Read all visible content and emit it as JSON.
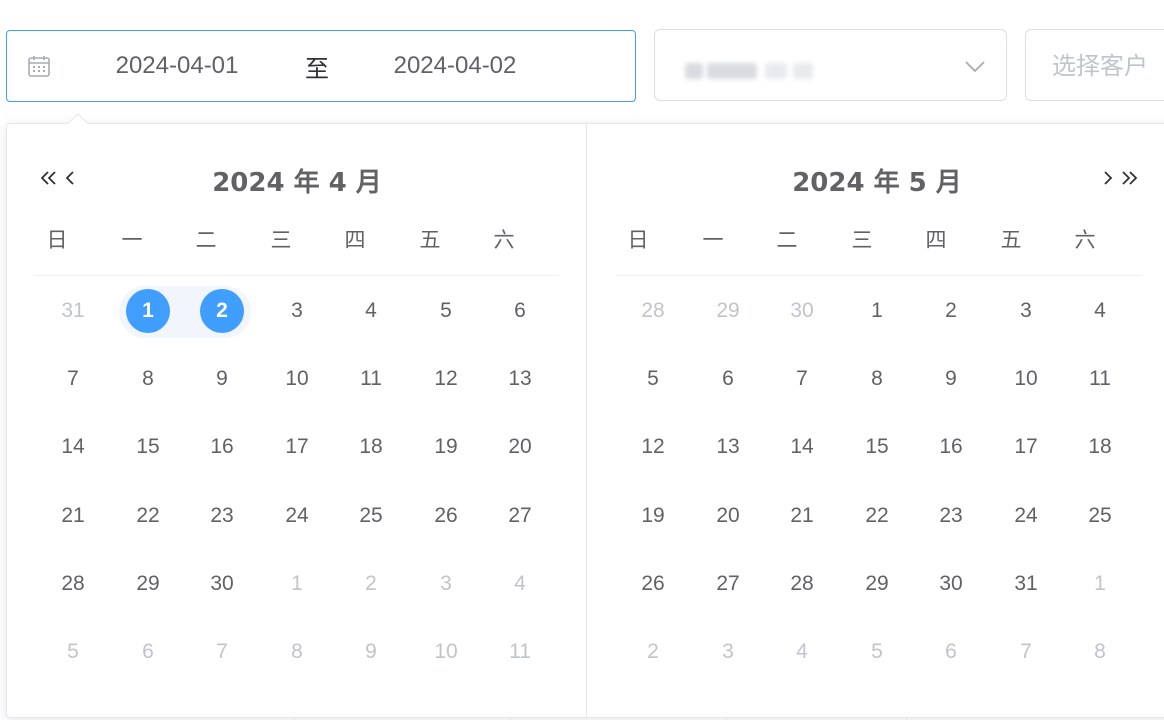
{
  "date_range": {
    "start": "2024-04-01",
    "separator": "至",
    "end": "2024-04-02"
  },
  "customer": {
    "placeholder": "选择客户"
  },
  "colors": {
    "accent": "#409eff",
    "range_band": "#f2f6fc",
    "text": "#606266",
    "muted": "#c0c4cc",
    "border": "#dcdfe6"
  },
  "icons": {
    "date_input": "calendar-icon",
    "select": "chevron-down-icon",
    "prev_year": "double-chevron-left-icon",
    "prev_month": "chevron-left-icon",
    "next_month": "chevron-right-icon",
    "next_year": "double-chevron-right-icon"
  },
  "weekdays": [
    "日",
    "一",
    "二",
    "三",
    "四",
    "五",
    "六"
  ],
  "calendars": [
    {
      "title": "2024 年 4 月",
      "weeks": [
        [
          {
            "d": "31",
            "o": true
          },
          {
            "d": "1",
            "s": true
          },
          {
            "d": "2",
            "s": true
          },
          {
            "d": "3"
          },
          {
            "d": "4"
          },
          {
            "d": "5"
          },
          {
            "d": "6"
          }
        ],
        [
          {
            "d": "7"
          },
          {
            "d": "8"
          },
          {
            "d": "9"
          },
          {
            "d": "10"
          },
          {
            "d": "11"
          },
          {
            "d": "12"
          },
          {
            "d": "13"
          }
        ],
        [
          {
            "d": "14"
          },
          {
            "d": "15"
          },
          {
            "d": "16"
          },
          {
            "d": "17"
          },
          {
            "d": "18"
          },
          {
            "d": "19"
          },
          {
            "d": "20"
          }
        ],
        [
          {
            "d": "21"
          },
          {
            "d": "22"
          },
          {
            "d": "23"
          },
          {
            "d": "24"
          },
          {
            "d": "25"
          },
          {
            "d": "26"
          },
          {
            "d": "27"
          }
        ],
        [
          {
            "d": "28"
          },
          {
            "d": "29"
          },
          {
            "d": "30"
          },
          {
            "d": "1",
            "o": true
          },
          {
            "d": "2",
            "o": true
          },
          {
            "d": "3",
            "o": true
          },
          {
            "d": "4",
            "o": true
          }
        ],
        [
          {
            "d": "5",
            "o": true
          },
          {
            "d": "6",
            "o": true
          },
          {
            "d": "7",
            "o": true
          },
          {
            "d": "8",
            "o": true
          },
          {
            "d": "9",
            "o": true
          },
          {
            "d": "10",
            "o": true
          },
          {
            "d": "11",
            "o": true
          }
        ]
      ]
    },
    {
      "title": "2024 年 5 月",
      "weeks": [
        [
          {
            "d": "28",
            "o": true
          },
          {
            "d": "29",
            "o": true
          },
          {
            "d": "30",
            "o": true
          },
          {
            "d": "1"
          },
          {
            "d": "2"
          },
          {
            "d": "3"
          },
          {
            "d": "4"
          }
        ],
        [
          {
            "d": "5"
          },
          {
            "d": "6"
          },
          {
            "d": "7"
          },
          {
            "d": "8"
          },
          {
            "d": "9"
          },
          {
            "d": "10"
          },
          {
            "d": "11"
          }
        ],
        [
          {
            "d": "12"
          },
          {
            "d": "13"
          },
          {
            "d": "14"
          },
          {
            "d": "15"
          },
          {
            "d": "16"
          },
          {
            "d": "17"
          },
          {
            "d": "18"
          }
        ],
        [
          {
            "d": "19"
          },
          {
            "d": "20"
          },
          {
            "d": "21"
          },
          {
            "d": "22"
          },
          {
            "d": "23"
          },
          {
            "d": "24"
          },
          {
            "d": "25"
          }
        ],
        [
          {
            "d": "26"
          },
          {
            "d": "27"
          },
          {
            "d": "28"
          },
          {
            "d": "29"
          },
          {
            "d": "30"
          },
          {
            "d": "31"
          },
          {
            "d": "1",
            "o": true
          }
        ],
        [
          {
            "d": "2",
            "o": true
          },
          {
            "d": "3",
            "o": true
          },
          {
            "d": "4",
            "o": true
          },
          {
            "d": "5",
            "o": true
          },
          {
            "d": "6",
            "o": true
          },
          {
            "d": "7",
            "o": true
          },
          {
            "d": "8",
            "o": true
          }
        ]
      ]
    }
  ]
}
